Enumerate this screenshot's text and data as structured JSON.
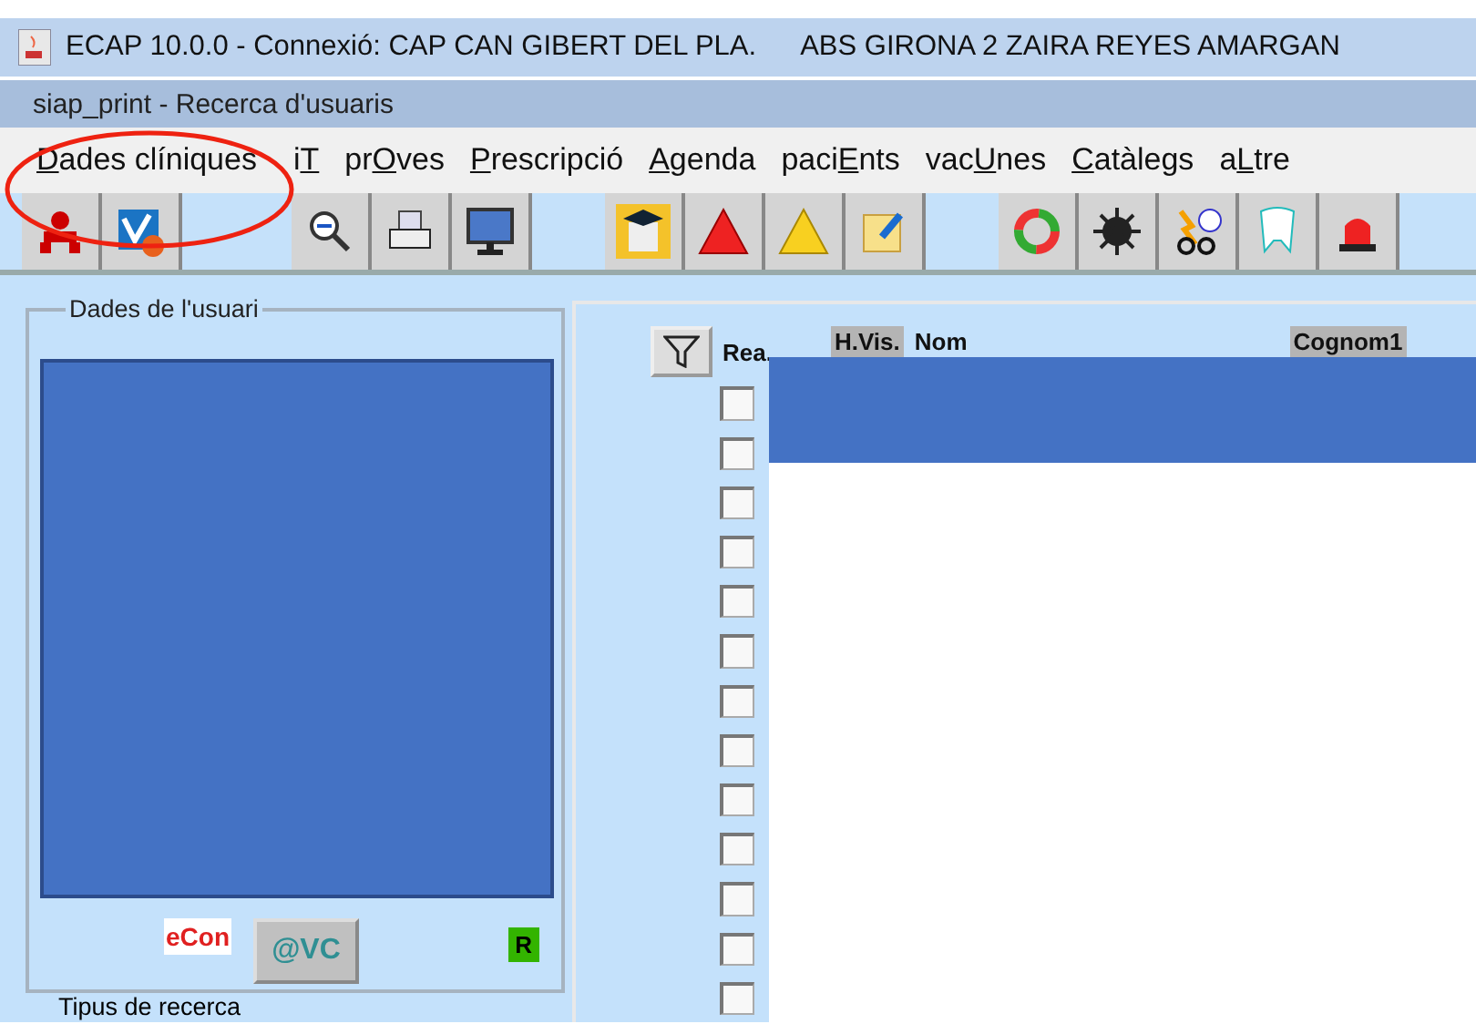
{
  "window": {
    "title": "ECAP 10.0.0 - Connexió: CAP CAN GIBERT DEL PLA.",
    "title_extra": "ABS GIRONA 2 ZAIRA REYES AMARGAN"
  },
  "subtitle": "siap_print - Recerca d'usuaris",
  "menu": [
    {
      "key": "D",
      "after": "ades clíniques"
    },
    {
      "before": "i",
      "key": "T"
    },
    {
      "before": "pr",
      "key": "O",
      "after": "ves"
    },
    {
      "key": "P",
      "after": "rescripció"
    },
    {
      "key": "A",
      "after": "genda"
    },
    {
      "before": "paci",
      "key": "E",
      "after": "nts"
    },
    {
      "before": "vac",
      "key": "U",
      "after": "nes"
    },
    {
      "key": "C",
      "after": "atàlegs"
    },
    {
      "before": "a",
      "key": "L",
      "after": "tre"
    }
  ],
  "user_panel": {
    "title": "Dades de l'usuari",
    "econ": "eCon",
    "vc_button": "@VC",
    "r_badge": "R",
    "search_type": "Tipus de recerca"
  },
  "results": {
    "check_header": "Rea.",
    "columns": [
      {
        "label": "H.Vis.",
        "shaded": true
      },
      {
        "label": "Nom",
        "shaded": false
      },
      {
        "label": "Cognom1",
        "shaded": true
      }
    ],
    "rows": [
      {
        "checked": false,
        "selected": true
      },
      {
        "checked": false,
        "selected": true
      },
      {
        "checked": false,
        "selected": false
      },
      {
        "checked": false,
        "selected": false
      },
      {
        "checked": false,
        "selected": false
      },
      {
        "checked": false,
        "selected": false
      },
      {
        "checked": false,
        "selected": false
      },
      {
        "checked": false,
        "selected": false
      },
      {
        "checked": false,
        "selected": false
      },
      {
        "checked": false,
        "selected": false
      },
      {
        "checked": false,
        "selected": false
      },
      {
        "checked": false,
        "selected": false
      },
      {
        "checked": false,
        "selected": false
      }
    ]
  }
}
